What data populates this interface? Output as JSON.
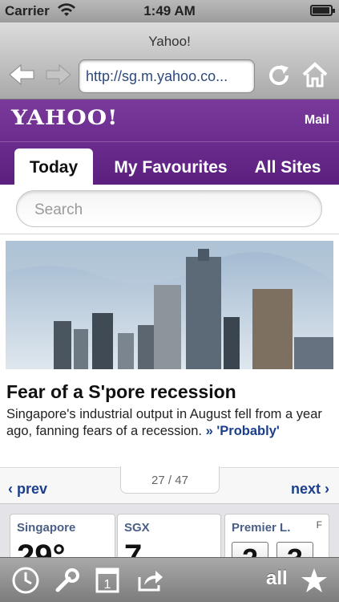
{
  "status_bar": {
    "carrier": "Carrier",
    "time": "1:49 AM",
    "battery_level": 0.95
  },
  "browser": {
    "title": "Yahoo!",
    "url": "http://sg.m.yahoo.co...",
    "icons": [
      "back-arrow-icon",
      "forward-arrow-icon",
      "reload-icon",
      "home-icon"
    ]
  },
  "yahoo": {
    "logo": "YAHOO!",
    "mail_link": "Mail",
    "tabs": [
      {
        "label": "Today",
        "active": true
      },
      {
        "label": "My Favourites",
        "active": false
      },
      {
        "label": "All Sites",
        "active": false
      }
    ]
  },
  "search": {
    "placeholder": "Search"
  },
  "story": {
    "title": "Fear of a S'pore recession",
    "text": "Singapore's industrial output in August fell from a year ago, fanning fears of a recession.",
    "more_prefix": "»",
    "more_link": "'Probably'"
  },
  "pager": {
    "prev": "prev",
    "next": "next",
    "current": "27",
    "total": "47"
  },
  "widgets": [
    {
      "name": "Singapore",
      "value": "29°"
    },
    {
      "name": "SGX",
      "value": "7"
    },
    {
      "name": "Premier L.",
      "flag": "F",
      "scores": [
        "2",
        "3"
      ]
    }
  ],
  "toolbar": {
    "all_label": "all",
    "icons": [
      "history-clock-icon",
      "wrench-icon",
      "tabs-icon",
      "share-icon",
      "bookmark-star-icon"
    ],
    "tabs_count": "1"
  }
}
